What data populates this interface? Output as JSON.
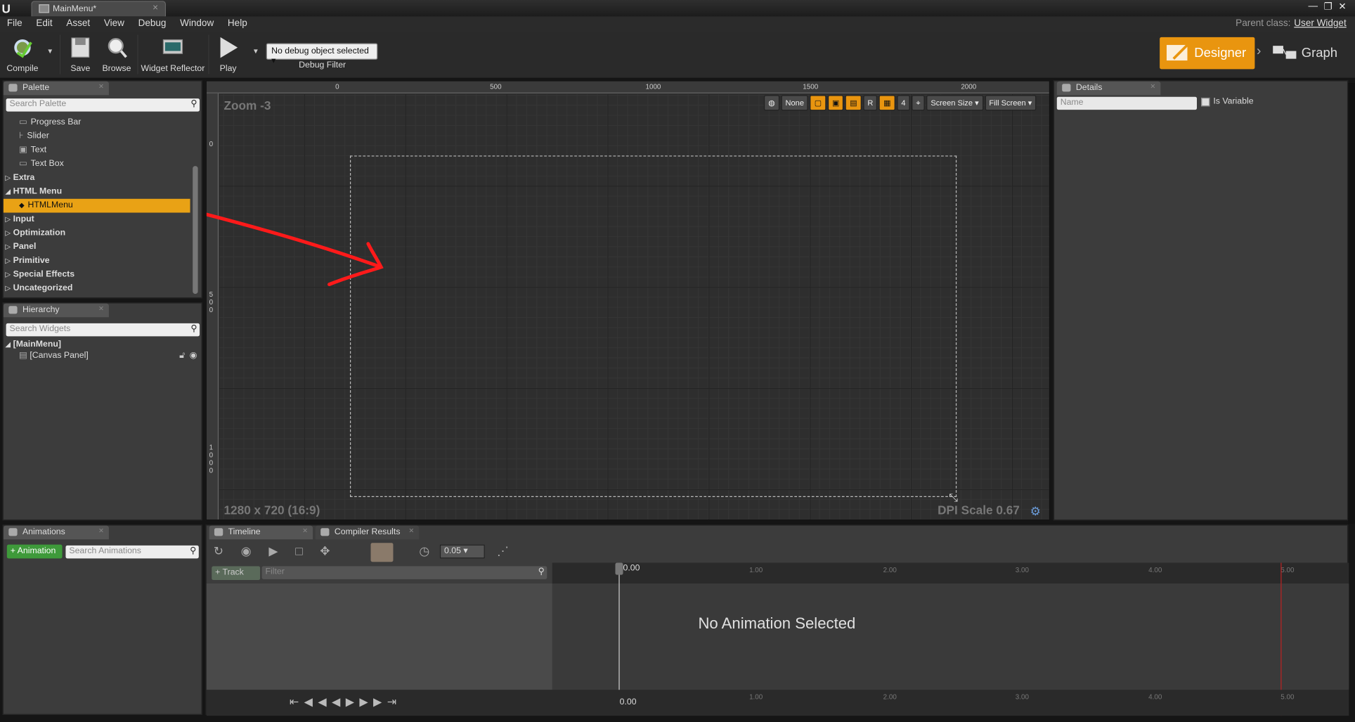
{
  "window": {
    "tab_title": "MainMenu*",
    "parent_class_label": "Parent class:",
    "parent_class_value": "User Widget"
  },
  "menubar": [
    "File",
    "Edit",
    "Asset",
    "View",
    "Debug",
    "Window",
    "Help"
  ],
  "toolbar": {
    "compile": "Compile",
    "save": "Save",
    "browse": "Browse",
    "widget_reflector": "Widget Reflector",
    "play": "Play",
    "debug_select": "No debug object selected",
    "debug_filter": "Debug Filter"
  },
  "modes": {
    "designer": "Designer",
    "graph": "Graph"
  },
  "palette": {
    "tab": "Palette",
    "search_placeholder": "Search Palette",
    "items": [
      {
        "label": "Progress Bar"
      },
      {
        "label": "Slider"
      },
      {
        "label": "Text"
      },
      {
        "label": "Text Box"
      }
    ],
    "categories": [
      "Extra",
      "HTML Menu",
      "Input",
      "Optimization",
      "Panel",
      "Primitive",
      "Special Effects",
      "Uncategorized"
    ],
    "selected_widget": "HTMLMenu"
  },
  "hierarchy": {
    "tab": "Hierarchy",
    "search_placeholder": "Search Widgets",
    "root": "[MainMenu]",
    "child": "[Canvas Panel]"
  },
  "viewport": {
    "zoom": "Zoom -3",
    "resolution": "1280 x 720 (16:9)",
    "dpi": "DPI Scale 0.67",
    "ruler_top": [
      "0",
      "500",
      "1000",
      "1500",
      "2000"
    ],
    "ruler_left": [
      "0",
      "5\n0\n0",
      "1\n0\n0\n0"
    ],
    "tools": {
      "none": "None",
      "r": "R",
      "grid": "4",
      "screen_size": "Screen Size",
      "fill_screen": "Fill Screen"
    }
  },
  "details": {
    "tab": "Details",
    "name_placeholder": "Name",
    "is_variable": "Is Variable"
  },
  "animations": {
    "tab": "Animations",
    "add_button": "+ Animation",
    "search_placeholder": "Search Animations"
  },
  "timeline": {
    "tab": "Timeline",
    "compiler_tab": "Compiler Results",
    "step": "0.05",
    "track_button": "+ Track",
    "filter_placeholder": "Filter",
    "playhead": "0.00",
    "ticks": [
      "1.00",
      "2.00",
      "3.00",
      "4.00",
      "5.00"
    ],
    "empty_message": "No Animation Selected"
  }
}
